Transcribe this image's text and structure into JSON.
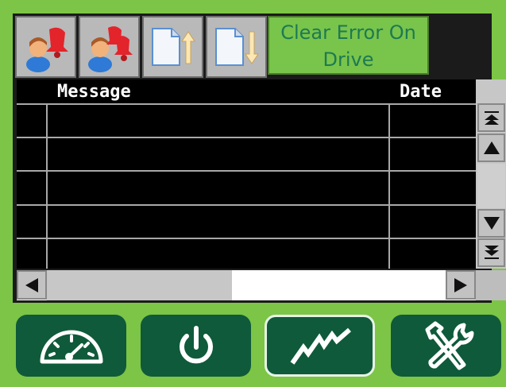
{
  "toolbar": {
    "buttons": [
      {
        "icon": "user-alarm-icon",
        "label": ""
      },
      {
        "icon": "user-alarm-multi-icon",
        "label": ""
      },
      {
        "icon": "page-up-icon",
        "label": ""
      },
      {
        "icon": "page-down-icon",
        "label": ""
      }
    ],
    "clear_error": {
      "line1": "Clear Error On",
      "line2": "Drive"
    }
  },
  "table": {
    "columns": [
      "",
      "Message",
      "Date"
    ],
    "rows": [
      [
        "",
        "",
        ""
      ],
      [
        "",
        "",
        ""
      ],
      [
        "",
        "",
        ""
      ],
      [
        "",
        "",
        ""
      ],
      [
        "",
        "",
        ""
      ]
    ]
  },
  "scroll": {
    "vertical": [
      "scroll-top-icon",
      "scroll-up-icon",
      "scroll-down-icon",
      "scroll-bottom-icon"
    ],
    "horizontal": [
      "scroll-left-icon",
      "scroll-right-icon"
    ]
  },
  "nav": [
    {
      "icon": "speedometer-icon",
      "active": false
    },
    {
      "icon": "power-icon",
      "active": false
    },
    {
      "icon": "trend-icon",
      "active": true
    },
    {
      "icon": "tools-icon",
      "active": false
    }
  ],
  "colors": {
    "background": "#7cc546",
    "nav": "#0f5a3a",
    "button_text": "#1d7a52"
  }
}
